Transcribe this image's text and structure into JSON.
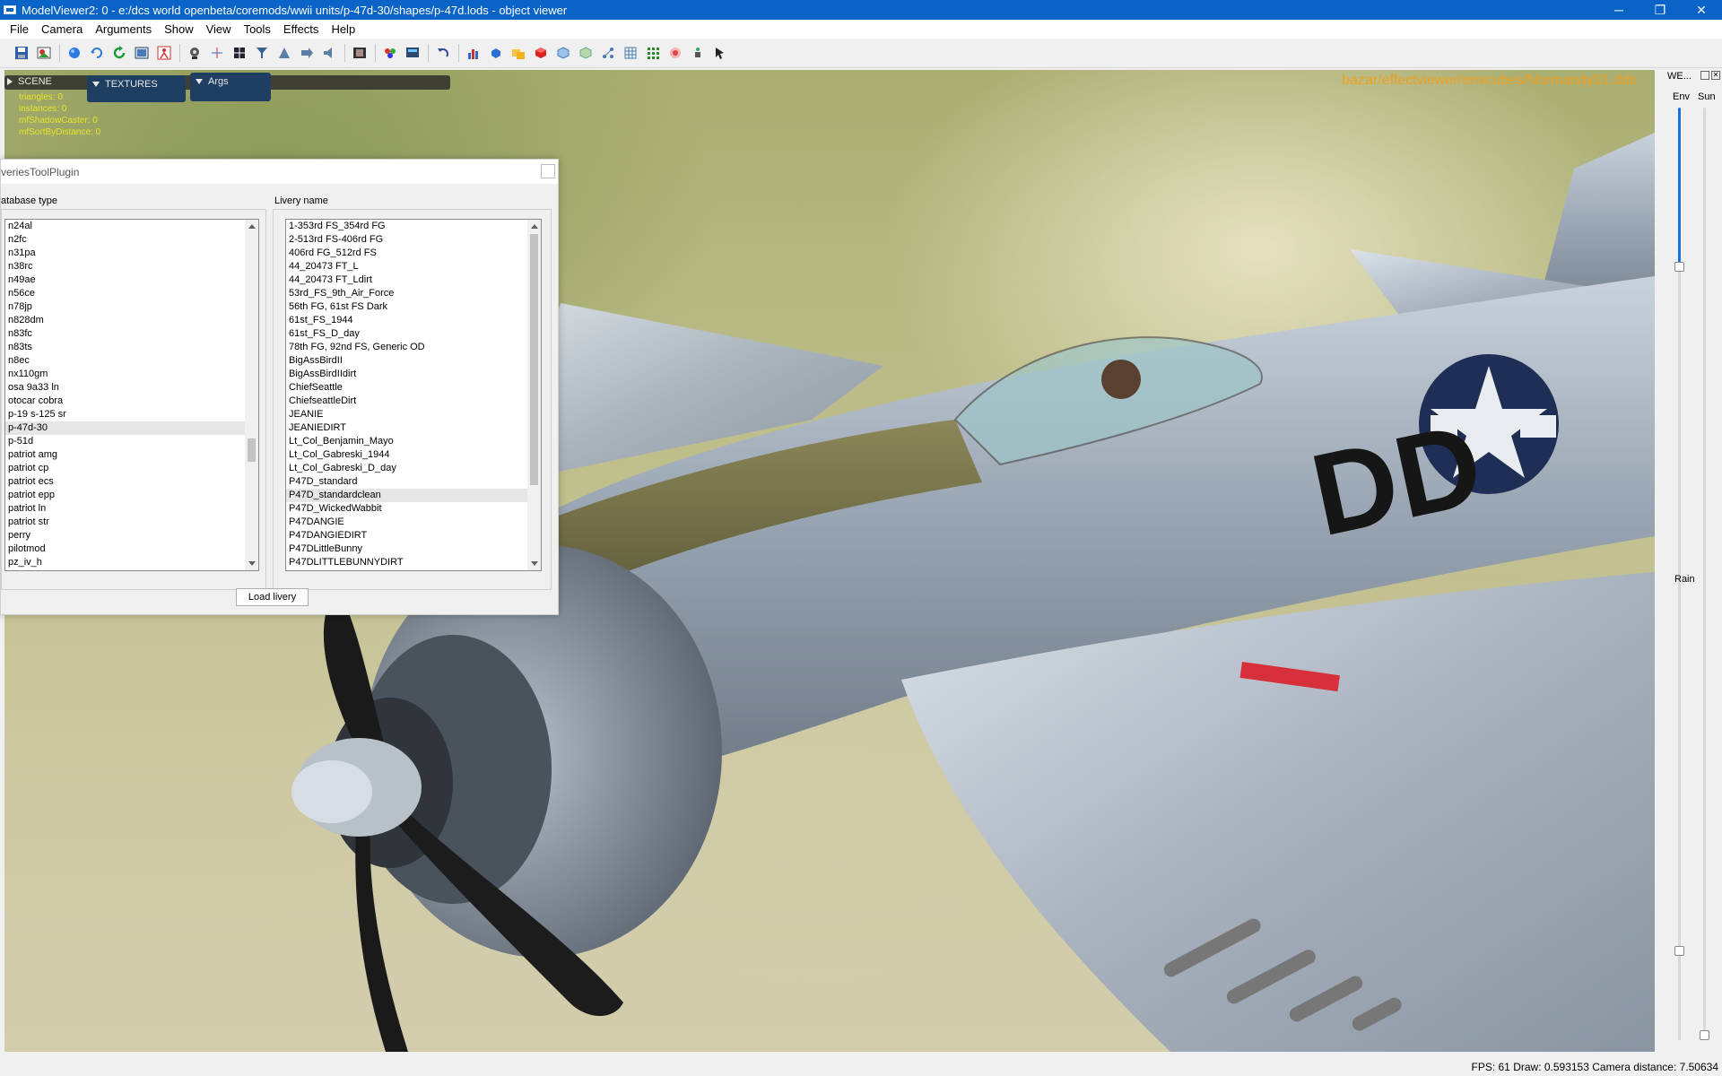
{
  "window": {
    "title": "ModelViewer2: 0 - e:/dcs world openbeta/coremods/wwii units/p-47d-30/shapes/p-47d.lods - object viewer",
    "minimize": "─",
    "restore": "❐",
    "close": "✕"
  },
  "menu": [
    "File",
    "Camera",
    "Arguments",
    "Show",
    "View",
    "Tools",
    "Effects",
    "Help"
  ],
  "toolbar_icons": [
    "save-icon",
    "open-model-icon",
    "sphere-icon",
    "refresh-icon",
    "reload-icon",
    "screenshot-icon",
    "person-icon",
    "lights-icon",
    "axis-icon",
    "grid-box-icon",
    "funnel-icon",
    "cone-icon",
    "arrow-right-icon",
    "speaker-icon",
    "film-icon",
    "paint-icon",
    "monitor-icon",
    "undo-icon",
    "bar-chart-icon",
    "blue-cube-icon",
    "folder-icon",
    "red-cube-icon",
    "cube-outline-icon",
    "green-cube-icon",
    "node-icon",
    "grid-icon",
    "dots-grid-icon",
    "target-icon",
    "figure-icon",
    "cursor-icon"
  ],
  "viewport": {
    "scene_label": "SCENE",
    "textures_label": "TEXTURES",
    "args_label": "Args",
    "stats": [
      "triangles: 0",
      "instances: 0",
      "mfShadowCaster: 0",
      "mfSortByDistance: 0"
    ],
    "env_path": "bazar/effectviewer/envcubes/Normandy01.dds",
    "colors": {
      "env_path": "#f0a020",
      "stats": "#e3e62a"
    }
  },
  "right_panel": {
    "title": "WE...",
    "env_label": "Env",
    "sun_label": "Sun",
    "rain_label": "Rain",
    "env_level": 0.7,
    "sun_level": 0.0,
    "rain_level": 0.2
  },
  "status": {
    "text": "FPS: 61  Draw: 0.593153  Camera distance: 7.50634"
  },
  "dialog": {
    "title": "veriesToolPlugin",
    "database_label": "atabase type",
    "livery_label": "Livery name",
    "load_button": "Load livery",
    "database_items": [
      "n24al",
      "n2fc",
      "n31pa",
      "n38rc",
      "n49ae",
      "n56ce",
      "n78jp",
      "n828dm",
      "n83fc",
      "n83ts",
      "n8ec",
      "nx110gm",
      "osa 9a33 ln",
      "otocar cobra",
      "p-19 s-125 sr",
      "p-47d-30",
      "p-51d",
      "patriot amg",
      "patriot cp",
      "patriot ecs",
      "patriot epp",
      "patriot ln",
      "patriot str",
      "perry",
      "pilotmod",
      "pz_iv_h"
    ],
    "database_selected": "p-47d-30",
    "livery_items": [
      "1-353rd FS_354rd FG",
      "2-513rd FS-406rd FG",
      "406rd FG_512rd FS",
      "44_20473  FT_L",
      "44_20473  FT_Ldirt",
      "53rd_FS_9th_Air_Force",
      "56th FG, 61st FS Dark",
      "61st_FS_1944",
      "61st_FS_D_day",
      "78th FG, 92nd FS, Generic OD",
      "BigAssBirdII",
      "BigAssBirdIIdirt",
      "ChiefSeattle",
      "ChiefseattleDirt",
      "JEANIE",
      "JEANIEDIRT",
      "Lt_Col_Benjamin_Mayo",
      "Lt_Col_Gabreski_1944",
      "Lt_Col_Gabreski_D_day",
      "P47D_standard",
      "P47D_standardclean",
      "P47D_WickedWabbit",
      "P47DANGIE",
      "P47DANGIEDIRT",
      "P47DLittleBunny",
      "P47DLITTLEBUNNYDIRT"
    ],
    "livery_selected": "P47D_standardclean"
  }
}
